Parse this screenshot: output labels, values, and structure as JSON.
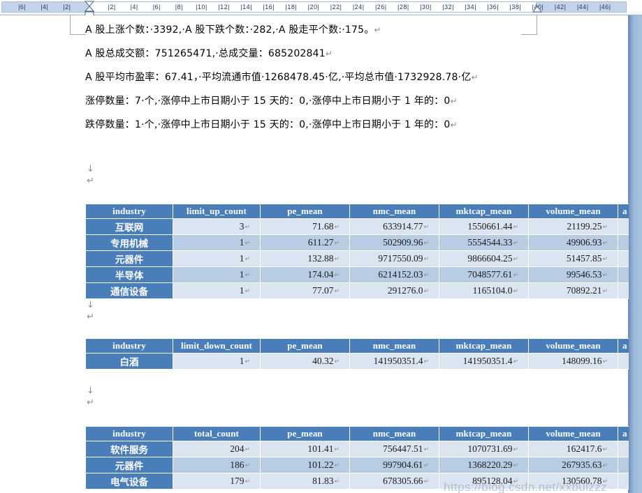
{
  "ruler": {
    "name": "horizontal-ruler",
    "unit_ticks": [
      "6",
      "4",
      "2",
      "",
      "2",
      "4",
      "6",
      "8",
      "10",
      "12",
      "14",
      "16",
      "18",
      "20",
      "22",
      "24",
      "26",
      "28",
      "30",
      "32",
      "34",
      "36",
      "38",
      "40",
      "42",
      "44",
      "46"
    ],
    "left_indent_label": "left-indent-marker",
    "right_indent_label": "right-indent-marker"
  },
  "document": {
    "paragraphs": [
      {
        "id": "p1",
        "text": "A 股上涨个数：·3392,·A 股下跌个数：·282,·A 股走平个数:·175。",
        "mark": "↵"
      },
      {
        "id": "p2",
        "text": "A 股总成交额：751265471,·总成交量：685202841",
        "mark": "↵"
      },
      {
        "id": "p3",
        "text": "A 股平均市盈率：67.41，·平均流通市值·1268478.45·亿,·平均总市值·1732928.78·亿",
        "mark": "↵"
      },
      {
        "id": "p4",
        "text": "涨停数量：7·个,·涨停中上市日期小于 15 天的：0,·涨停中上市日期小于 1 年的：0",
        "mark": "↵"
      },
      {
        "id": "p5",
        "text": "跌停数量：1·个,·涨停中上市日期小于 15 天的：0,·涨停中上市日期小于 1 年的：0",
        "mark": "↵"
      }
    ],
    "break_marks": [
      {
        "id": "bm1",
        "down": "↓",
        "ret": "↵"
      },
      {
        "id": "bm2",
        "down": "↓",
        "ret": "↵"
      },
      {
        "id": "bm3",
        "down": "↓",
        "ret": "↵"
      }
    ],
    "cell_mark": "↵",
    "watermark": "https://blog.csdn.net/xxbulzzz"
  },
  "tables": [
    {
      "id": "limit-up-table",
      "name": "limit-up-industry-table",
      "headers": [
        "industry",
        "limit_up_count",
        "pe_mean",
        "nmc_mean",
        "mktcap_mean",
        "volume_mean",
        "a"
      ],
      "rows": [
        [
          "互联网",
          "3",
          "71.68",
          "633914.77",
          "1550661.44",
          "21199.25"
        ],
        [
          "专用机械",
          "1",
          "611.27",
          "502909.96",
          "5554544.33",
          "49906.93"
        ],
        [
          "元器件",
          "1",
          "132.88",
          "9717550.09",
          "9866604.25",
          "51457.85"
        ],
        [
          "半导体",
          "1",
          "174.04",
          "6214152.03",
          "7048577.61",
          "99546.53"
        ],
        [
          "通信设备",
          "1",
          "77.07",
          "291276.0",
          "1165104.0",
          "70892.21"
        ]
      ]
    },
    {
      "id": "limit-down-table",
      "name": "limit-down-industry-table",
      "headers": [
        "industry",
        "limit_down_count",
        "pe_mean",
        "nmc_mean",
        "mktcap_mean",
        "volume_mean",
        "a"
      ],
      "rows": [
        [
          "白酒",
          "1",
          "40.32",
          "141950351.4",
          "141950351.4",
          "148099.16"
        ]
      ]
    },
    {
      "id": "total-count-table",
      "name": "total-count-industry-table",
      "headers": [
        "industry",
        "total_count",
        "pe_mean",
        "nmc_mean",
        "mktcap_mean",
        "volume_mean",
        "a"
      ],
      "rows": [
        [
          "软件服务",
          "204",
          "101.41",
          "756447.51",
          "1070731.69",
          "162417.6"
        ],
        [
          "元器件",
          "186",
          "101.22",
          "997904.61",
          "1368220.29",
          "267935.63"
        ],
        [
          "电气设备",
          "179",
          "81.83",
          "678305.66",
          "895128.04",
          "130560.78"
        ]
      ]
    }
  ],
  "colors": {
    "header_blue": "#4A7EBB",
    "band_light": "#DBE5F1",
    "band_medium": "#B8CCE4",
    "page_background": "#8FAFD4"
  }
}
